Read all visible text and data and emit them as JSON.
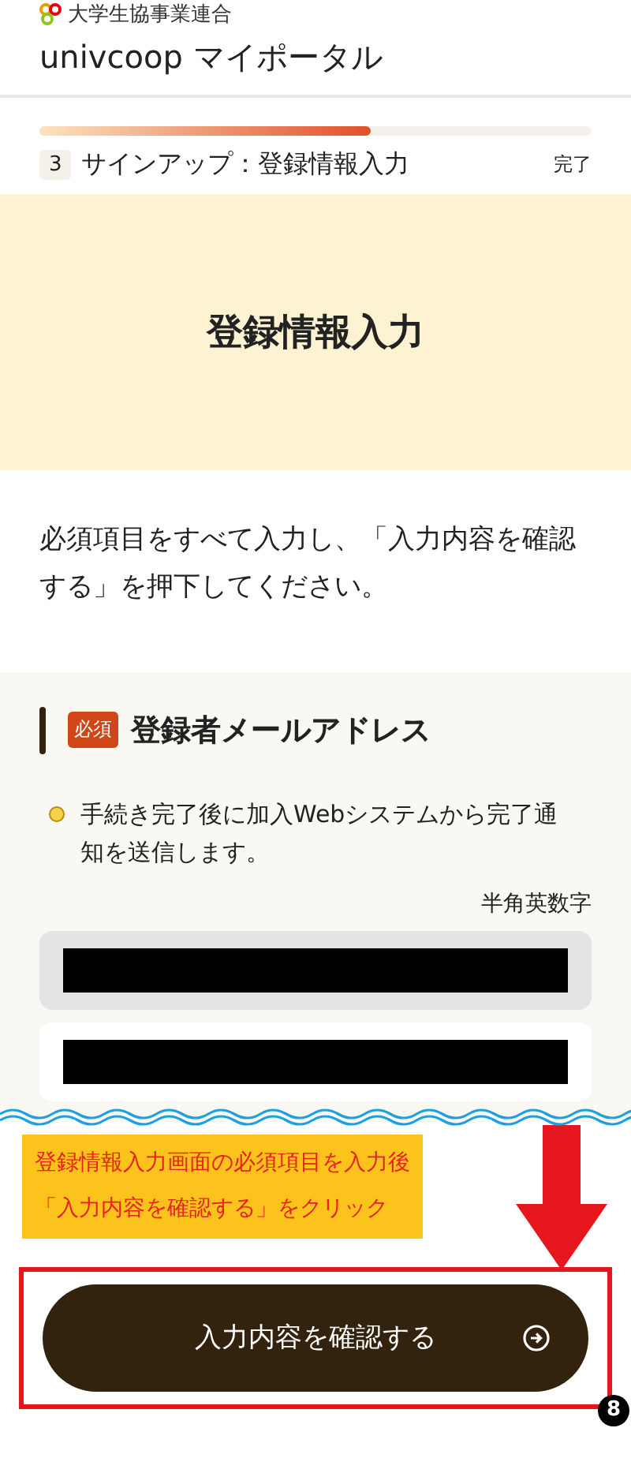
{
  "header": {
    "org_name": "大学生協事業連合",
    "title": "univcoop マイポータル"
  },
  "progress": {
    "level": 0.6,
    "step_number": "3",
    "step_label": "サインアップ：登録情報入力",
    "end_label": "完了"
  },
  "page_title": "登録情報入力",
  "instruction": "必須項目をすべて入力し、「入力内容を確認する」を押下してください。",
  "section": {
    "required_badge": "必須",
    "heading": "登録者メールアドレス",
    "note": "手続き完了後に加入Webシステムから完了通知を送信します。",
    "format_hint": "半角英数字",
    "fields": [
      {
        "disabled": true
      },
      {
        "disabled": false
      }
    ]
  },
  "annotation": {
    "lines": [
      "登録情報入力画面の必須項目を入力後",
      "「入力内容を確認する」をクリック"
    ],
    "step_badge": "8"
  },
  "submit_button": {
    "label": "入力内容を確認する"
  }
}
